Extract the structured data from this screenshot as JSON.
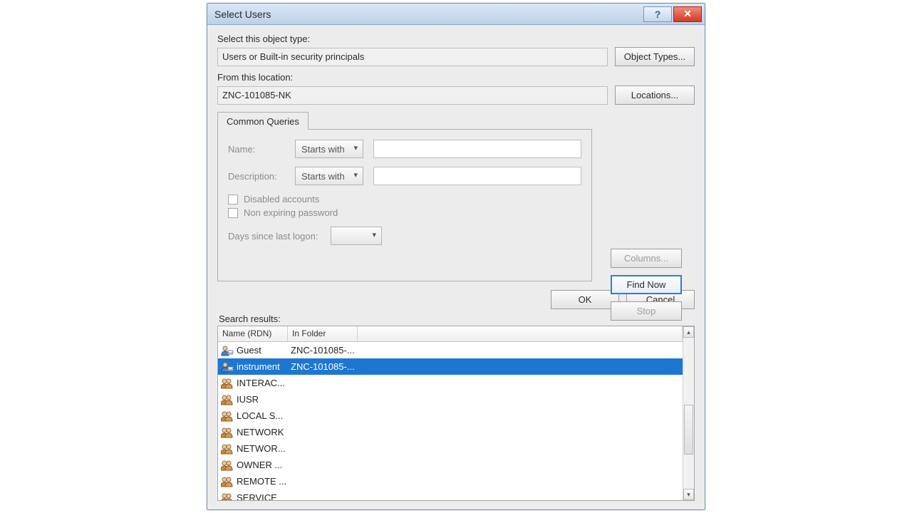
{
  "window": {
    "title": "Select Users"
  },
  "objectType": {
    "label": "Select this object type:",
    "value": "Users or Built-in security principals",
    "button": "Object Types..."
  },
  "location": {
    "label": "From this location:",
    "value": "ZNC-101085-NK",
    "button": "Locations..."
  },
  "queries": {
    "tab": "Common Queries",
    "nameLabel": "Name:",
    "descLabel": "Description:",
    "nameMatch": "Starts with",
    "descMatch": "Starts with",
    "disabled": "Disabled accounts",
    "nonexpire": "Non expiring password",
    "daysLabel": "Days since last logon:"
  },
  "side": {
    "columns": "Columns...",
    "findNow": "Find Now",
    "stop": "Stop"
  },
  "footer": {
    "ok": "OK",
    "cancel": "Cancel",
    "resultsLabel": "Search results:"
  },
  "grid": {
    "col1": "Name (RDN)",
    "col2": "In Folder",
    "rows": [
      {
        "icon": "user",
        "name": "Guest",
        "folder": "ZNC-101085-...",
        "selected": false
      },
      {
        "icon": "user",
        "name": "instrument",
        "folder": "ZNC-101085-...",
        "selected": true
      },
      {
        "icon": "group",
        "name": "INTERAC...",
        "folder": "",
        "selected": false
      },
      {
        "icon": "group",
        "name": "IUSR",
        "folder": "",
        "selected": false
      },
      {
        "icon": "group",
        "name": "LOCAL S...",
        "folder": "",
        "selected": false
      },
      {
        "icon": "group",
        "name": "NETWORK",
        "folder": "",
        "selected": false
      },
      {
        "icon": "group",
        "name": "NETWOR...",
        "folder": "",
        "selected": false
      },
      {
        "icon": "group",
        "name": "OWNER ...",
        "folder": "",
        "selected": false
      },
      {
        "icon": "group",
        "name": "REMOTE ...",
        "folder": "",
        "selected": false
      },
      {
        "icon": "group",
        "name": "SERVICE",
        "folder": "",
        "selected": false
      }
    ]
  }
}
